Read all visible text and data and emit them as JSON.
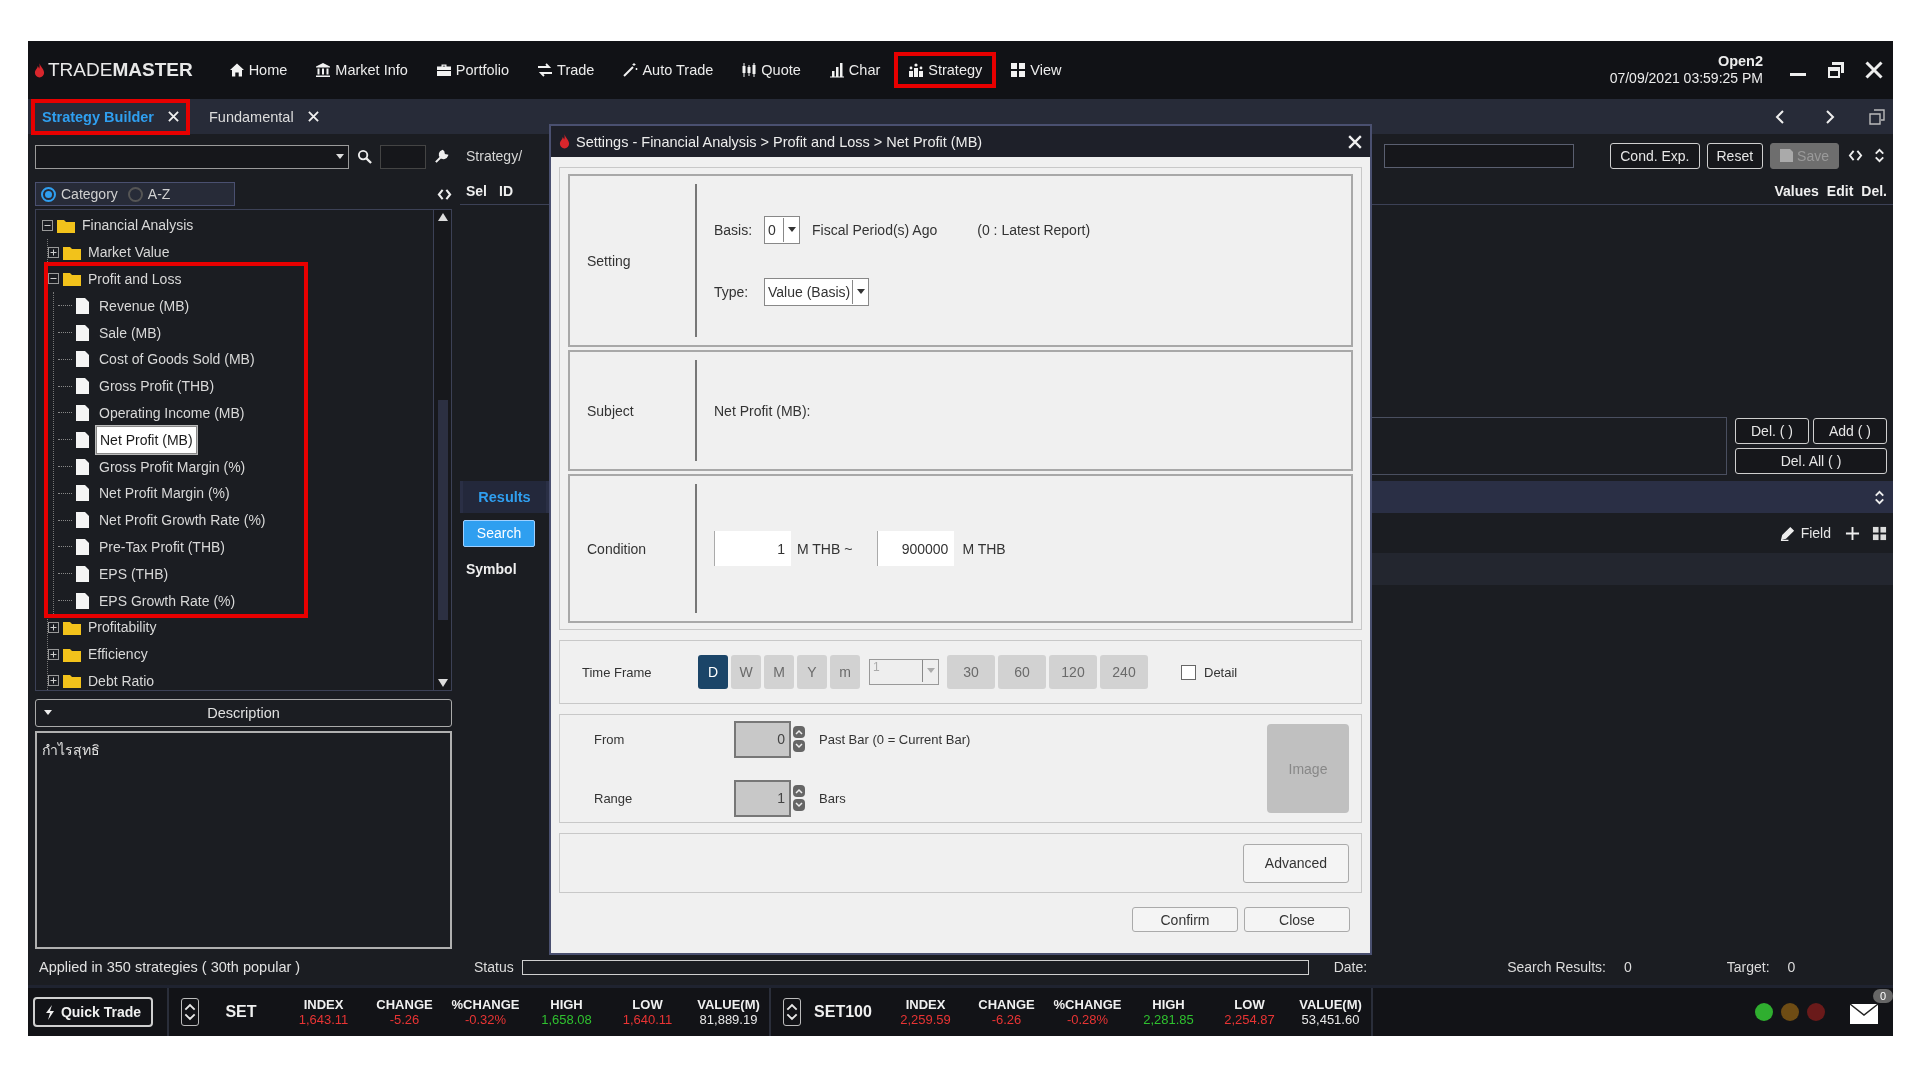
{
  "logo": "TRADE**MASTER**",
  "nav": [
    {
      "label": "Home",
      "highlighted": false
    },
    {
      "label": "Market Info",
      "highlighted": false
    },
    {
      "label": "Portfolio",
      "highlighted": false
    },
    {
      "label": "Trade",
      "highlighted": false
    },
    {
      "label": "Auto Trade",
      "highlighted": false
    },
    {
      "label": "Quote",
      "highlighted": false
    },
    {
      "label": "Char",
      "highlighted": false
    },
    {
      "label": "Strategy",
      "highlighted": true
    },
    {
      "label": "View",
      "highlighted": false
    }
  ],
  "session": {
    "status": "Open2",
    "datetime": "07/09/2021 03:59:25 PM"
  },
  "tabs": [
    {
      "label": "Strategy Builder",
      "selected": true,
      "highlighted": true
    },
    {
      "label": "Fundamental",
      "selected": false,
      "highlighted": false
    }
  ],
  "left_panel": {
    "view_options": [
      {
        "label": "Category",
        "selected": true
      },
      {
        "label": "A-Z",
        "selected": false
      }
    ],
    "tree": [
      {
        "label": "Financial Analysis",
        "kind": "folder",
        "expanded": true,
        "selected": false,
        "highlighted": false,
        "children": [
          {
            "label": "Market Value",
            "kind": "folder",
            "expanded": false,
            "selected": false,
            "highlighted": false
          },
          {
            "label": "Profit and Loss",
            "kind": "folder",
            "expanded": true,
            "selected": false,
            "highlighted": true,
            "children": [
              {
                "label": "Revenue (MB)",
                "kind": "item",
                "selected": false,
                "highlighted": false
              },
              {
                "label": "Sale (MB)",
                "kind": "item",
                "selected": false,
                "highlighted": false
              },
              {
                "label": "Cost of Goods Sold (MB)",
                "kind": "item",
                "selected": false,
                "highlighted": false
              },
              {
                "label": "Gross Profit (THB)",
                "kind": "item",
                "selected": false,
                "highlighted": false
              },
              {
                "label": "Operating Income (MB)",
                "kind": "item",
                "selected": false,
                "highlighted": false
              },
              {
                "label": "Net Profit (MB)",
                "kind": "item",
                "selected": true,
                "highlighted": false
              },
              {
                "label": "Gross Profit Margin (%)",
                "kind": "item",
                "selected": false,
                "highlighted": false
              },
              {
                "label": "Net Profit Margin (%)",
                "kind": "item",
                "selected": false,
                "highlighted": false
              },
              {
                "label": "Net Profit Growth Rate (%)",
                "kind": "item",
                "selected": false,
                "highlighted": false
              },
              {
                "label": "Pre-Tax Profit (THB)",
                "kind": "item",
                "selected": false,
                "highlighted": false
              },
              {
                "label": "EPS (THB)",
                "kind": "item",
                "selected": false,
                "highlighted": false
              },
              {
                "label": "EPS Growth Rate (%)",
                "kind": "item",
                "selected": false,
                "highlighted": false
              }
            ]
          },
          {
            "label": "Profitability",
            "kind": "folder",
            "expanded": false,
            "selected": false,
            "highlighted": false
          },
          {
            "label": "Efficiency",
            "kind": "folder",
            "expanded": false,
            "selected": false,
            "highlighted": false
          },
          {
            "label": "Debt Ratio",
            "kind": "folder",
            "expanded": false,
            "selected": false,
            "highlighted": false
          }
        ]
      }
    ],
    "description_title": "Description",
    "description": "กำไรสุทธิ",
    "usage": "Applied in 350 strategies ( 30th popular )"
  },
  "strategy_panel": {
    "label": "Strategy/",
    "columns_left": [
      "Sel",
      "ID"
    ],
    "columns_right": [
      "Values",
      "Edit",
      "Del."
    ],
    "toolbar_buttons": [
      {
        "label": "Cond. Exp.",
        "disabled": false
      },
      {
        "label": "Reset",
        "disabled": false
      },
      {
        "label": "Save",
        "disabled": true
      }
    ],
    "condition_buttons": [
      "Del. ( )",
      "Add ( )",
      "Del. All ( )"
    ],
    "results_tab": "Results",
    "search_button": "Search",
    "field_button": "Field",
    "symbol_column": "Symbol"
  },
  "status_bar": {
    "status_label": "Status",
    "progress": {
      "level": 0
    },
    "date_label": "Date:",
    "results_label": "Search Results:",
    "results_value": "0",
    "target_label": "Target:",
    "target_value": "0"
  },
  "dialog": {
    "title": "Settings - Financial Analysis > Profit and Loss > Net Profit (MB)",
    "setting": {
      "label": "Setting",
      "basis_label": "Basis:",
      "basis_value": "0",
      "basis_suffix": "Fiscal Period(s) Ago",
      "basis_hint": "(0 : Latest Report)",
      "type_label": "Type:",
      "type_value": "Value (Basis)"
    },
    "subject": {
      "label": "Subject",
      "value": "Net Profit (MB):"
    },
    "condition": {
      "label": "Condition",
      "min": "1",
      "min_unit": "M THB ~",
      "max": "900000",
      "max_unit": "M THB"
    },
    "time_frame": {
      "label": "Time Frame",
      "periods": [
        {
          "label": "D",
          "selected": true
        },
        {
          "label": "W",
          "selected": false
        },
        {
          "label": "M",
          "selected": false
        },
        {
          "label": "Y",
          "selected": false
        },
        {
          "label": "m",
          "selected": false
        }
      ],
      "count": {
        "value": "1",
        "disabled": true
      },
      "intervals": [
        {
          "label": "30",
          "disabled": true
        },
        {
          "label": "60",
          "disabled": true
        },
        {
          "label": "120",
          "disabled": true
        },
        {
          "label": "240",
          "disabled": true
        }
      ],
      "detail": {
        "label": "Detail",
        "checked": false
      }
    },
    "bars": {
      "from_label": "From",
      "from_value": "0",
      "from_hint": "Past Bar (0 = Current Bar)",
      "range_label": "Range",
      "range_value": "1",
      "range_hint": "Bars",
      "image_button": {
        "label": "Image",
        "disabled": true
      }
    },
    "advanced": "Advanced",
    "buttons": [
      "Confirm",
      "Close"
    ]
  },
  "ticker": {
    "quick_trade": "Quick Trade",
    "markets": [
      {
        "name": "SET",
        "fields": [
          {
            "label": "INDEX",
            "value": "1,643.11",
            "color": "#e83434"
          },
          {
            "label": "CHANGE",
            "value": "-5.26",
            "color": "#e83434"
          },
          {
            "label": "%CHANGE",
            "value": "-0.32%",
            "color": "#e83434"
          },
          {
            "label": "HIGH",
            "value": "1,658.08",
            "color": "#2fc02f"
          },
          {
            "label": "LOW",
            "value": "1,640.11",
            "color": "#e83434"
          },
          {
            "label": "VALUE(M)",
            "value": "81,889.19",
            "color": "#e8e8e8"
          }
        ]
      },
      {
        "name": "SET100",
        "fields": [
          {
            "label": "INDEX",
            "value": "2,259.59",
            "color": "#e83434"
          },
          {
            "label": "CHANGE",
            "value": "-6.26",
            "color": "#e83434"
          },
          {
            "label": "%CHANGE",
            "value": "-0.28%",
            "color": "#e83434"
          },
          {
            "label": "HIGH",
            "value": "2,281.85",
            "color": "#2fc02f"
          },
          {
            "label": "LOW",
            "value": "2,254.87",
            "color": "#e83434"
          },
          {
            "label": "VALUE(M)",
            "value": "53,451.60",
            "color": "#e8e8e8"
          }
        ]
      }
    ],
    "lights": [
      {
        "color": "#2fae2f"
      },
      {
        "color": "#6e4c14"
      },
      {
        "color": "#6a1a1a"
      }
    ],
    "mail_count": "0"
  }
}
